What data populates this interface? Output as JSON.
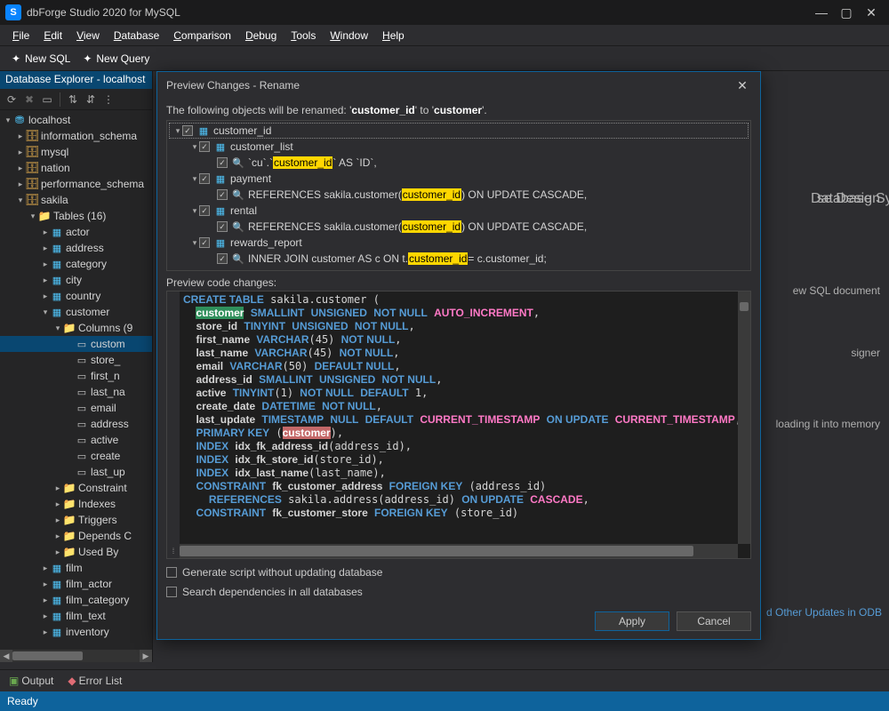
{
  "app": {
    "title": "dbForge Studio 2020 for MySQL",
    "logo_letter": "S"
  },
  "menu": [
    "File",
    "Edit",
    "View",
    "Database",
    "Comparison",
    "Debug",
    "Tools",
    "Window",
    "Help"
  ],
  "toolbar": {
    "new_sql": "New SQL",
    "new_query": "New Query"
  },
  "win_buttons": {
    "min": "—",
    "max": "▢",
    "close": "✕"
  },
  "explorer": {
    "title": "Database Explorer - localhost",
    "server": "localhost",
    "databases": [
      "information_schema",
      "mysql",
      "nation",
      "performance_schema"
    ],
    "active_db": "sakila",
    "tables_folder": "Tables (16)",
    "tables": [
      "actor",
      "address",
      "category",
      "city",
      "country",
      "customer"
    ],
    "columns_folder": "Columns (9",
    "columns": [
      "custom",
      "store_",
      "first_n",
      "last_na",
      "email",
      "address",
      "active",
      "create",
      "last_up"
    ],
    "customer_subfolders": [
      "Constraint",
      "Indexes",
      "Triggers",
      "Depends C",
      "Used By"
    ],
    "more_tables": [
      "film",
      "film_actor",
      "film_category",
      "film_text",
      "inventory"
    ]
  },
  "background_snips": {
    "design": "se Design",
    "dbsync": "Database Sy",
    "newsql_doc": "ew SQL document",
    "signer": "signer",
    "loading": "loading it into memory",
    "odac_link": "d Other Updates in ODB"
  },
  "dialog": {
    "title": "Preview Changes - Rename",
    "message_pre": "The following objects will be renamed: ",
    "rename_from": "customer_id",
    "rename_to": "customer",
    "tree": {
      "root": "customer_id",
      "items": [
        {
          "name": "customer_list",
          "icon": "table",
          "detail": {
            "pre": "`cu`.`",
            "hl": "customer_id",
            "post": "` AS `ID`,"
          }
        },
        {
          "name": "payment",
          "icon": "table",
          "detail": {
            "pre": "REFERENCES sakila.customer(",
            "hl": "customer_id",
            "post": ") ON UPDATE CASCADE,"
          }
        },
        {
          "name": "rental",
          "icon": "table",
          "detail": {
            "pre": "REFERENCES sakila.customer(",
            "hl": "customer_id",
            "post": ") ON UPDATE CASCADE,"
          }
        },
        {
          "name": "rewards_report",
          "icon": "table",
          "detail": {
            "pre": "INNER JOIN customer AS c ON t.",
            "hl": "customer_id",
            "post": " = c.customer_id;"
          }
        }
      ]
    },
    "preview_label": "Preview code changes:",
    "code_html": "<span class='kw'>CREATE TABLE</span> sakila.customer (\n  <span class='hlg id'>customer</span> <span class='kw'>SMALLINT</span> <span class='kw'>UNSIGNED</span> <span class='kw'>NOT NULL</span> <span class='pink'>AUTO_INCREMENT</span>,\n  <span class='id'>store_id</span> <span class='kw'>TINYINT</span> <span class='kw'>UNSIGNED</span> <span class='kw'>NOT NULL</span>,\n  <span class='id'>first_name</span> <span class='kw'>VARCHAR</span>(45) <span class='kw'>NOT NULL</span>,\n  <span class='id'>last_name</span> <span class='kw'>VARCHAR</span>(45) <span class='kw'>NOT NULL</span>,\n  <span class='id'>email</span> <span class='kw'>VARCHAR</span>(50) <span class='kw'>DEFAULT NULL</span>,\n  <span class='id'>address_id</span> <span class='kw'>SMALLINT</span> <span class='kw'>UNSIGNED</span> <span class='kw'>NOT NULL</span>,\n  <span class='id'>active</span> <span class='kw'>TINYINT</span>(1) <span class='kw'>NOT NULL</span> <span class='kw'>DEFAULT</span> 1,\n  <span class='id'>create_date</span> <span class='kw'>DATETIME</span> <span class='kw'>NOT NULL</span>,\n  <span class='id'>last_update</span> <span class='kw'>TIMESTAMP</span> <span class='kw'>NULL</span> <span class='kw'>DEFAULT</span> <span class='pink'>CURRENT_TIMESTAMP</span> <span class='kw'>ON UPDATE</span> <span class='pink'>CURRENT_TIMESTAMP</span>,\n  <span class='kw'>PRIMARY KEY</span> (<span class='hlr id'>customer</span>),\n  <span class='kw'>INDEX</span> <span class='id'>idx_fk_address_id</span>(address_id),\n  <span class='kw'>INDEX</span> <span class='id'>idx_fk_store_id</span>(store_id),\n  <span class='kw'>INDEX</span> <span class='id'>idx_last_name</span>(last_name),\n  <span class='kw'>CONSTRAINT</span> <span class='id'>fk_customer_address</span> <span class='kw'>FOREIGN KEY</span> (address_id)\n    <span class='kw'>REFERENCES</span> sakila.address(address_id) <span class='kw'>ON UPDATE</span> <span class='pink'>CASCADE</span>,\n  <span class='kw'>CONSTRAINT</span> <span class='id'>fk_customer_store</span> <span class='kw'>FOREIGN KEY</span> (store_id)",
    "checkbox1": "Generate script without updating database",
    "checkbox2": "Search dependencies in all databases",
    "apply": "Apply",
    "cancel": "Cancel"
  },
  "bottom": {
    "output": "Output",
    "errors": "Error List"
  },
  "status": "Ready"
}
